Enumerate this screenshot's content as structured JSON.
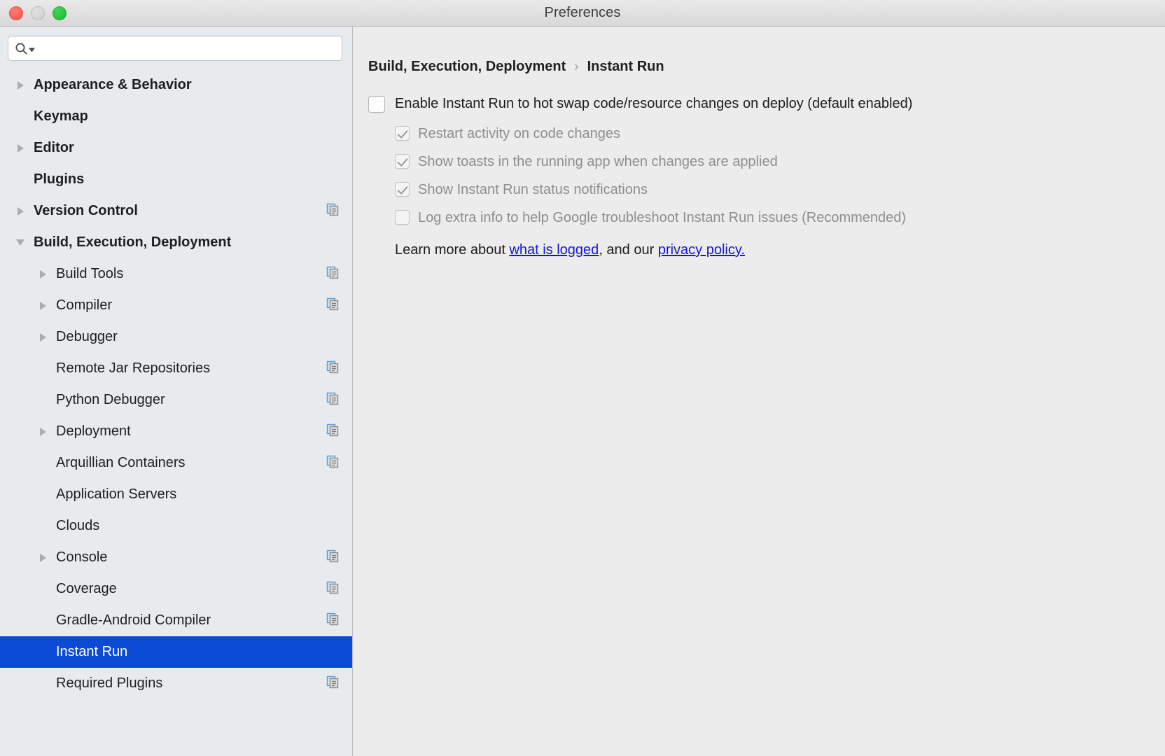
{
  "window": {
    "title": "Preferences",
    "traffic_lights": [
      "close-button",
      "minimize-button",
      "zoom-button"
    ]
  },
  "search": {
    "value": "",
    "placeholder": "",
    "icon": "search-icon",
    "dropdown_icon": "caret-down-icon"
  },
  "sidebar": {
    "items": [
      {
        "label": "Appearance & Behavior",
        "level": 0,
        "twisty": "right",
        "copy_icon": false,
        "selected": false
      },
      {
        "label": "Keymap",
        "level": 0,
        "twisty": "none",
        "copy_icon": false,
        "selected": false
      },
      {
        "label": "Editor",
        "level": 0,
        "twisty": "right",
        "copy_icon": false,
        "selected": false
      },
      {
        "label": "Plugins",
        "level": 0,
        "twisty": "none",
        "copy_icon": false,
        "selected": false
      },
      {
        "label": "Version Control",
        "level": 0,
        "twisty": "right",
        "copy_icon": true,
        "selected": false
      },
      {
        "label": "Build, Execution, Deployment",
        "level": 0,
        "twisty": "down",
        "copy_icon": false,
        "selected": false
      },
      {
        "label": "Build Tools",
        "level": 1,
        "twisty": "right",
        "copy_icon": true,
        "selected": false
      },
      {
        "label": "Compiler",
        "level": 1,
        "twisty": "right",
        "copy_icon": true,
        "selected": false
      },
      {
        "label": "Debugger",
        "level": 1,
        "twisty": "right",
        "copy_icon": false,
        "selected": false
      },
      {
        "label": "Remote Jar Repositories",
        "level": 1,
        "twisty": "none",
        "copy_icon": true,
        "selected": false
      },
      {
        "label": "Python Debugger",
        "level": 1,
        "twisty": "none",
        "copy_icon": true,
        "selected": false
      },
      {
        "label": "Deployment",
        "level": 1,
        "twisty": "right",
        "copy_icon": true,
        "selected": false
      },
      {
        "label": "Arquillian Containers",
        "level": 1,
        "twisty": "none",
        "copy_icon": true,
        "selected": false
      },
      {
        "label": "Application Servers",
        "level": 1,
        "twisty": "none",
        "copy_icon": false,
        "selected": false
      },
      {
        "label": "Clouds",
        "level": 1,
        "twisty": "none",
        "copy_icon": false,
        "selected": false
      },
      {
        "label": "Console",
        "level": 1,
        "twisty": "right",
        "copy_icon": true,
        "selected": false
      },
      {
        "label": "Coverage",
        "level": 1,
        "twisty": "none",
        "copy_icon": true,
        "selected": false
      },
      {
        "label": "Gradle-Android Compiler",
        "level": 1,
        "twisty": "none",
        "copy_icon": true,
        "selected": false
      },
      {
        "label": "Instant Run",
        "level": 1,
        "twisty": "none",
        "copy_icon": false,
        "selected": true
      },
      {
        "label": "Required Plugins",
        "level": 1,
        "twisty": "none",
        "copy_icon": true,
        "selected": false
      }
    ]
  },
  "content": {
    "breadcrumb": {
      "parent": "Build, Execution, Deployment",
      "separator": "›",
      "current": "Instant Run"
    },
    "options": [
      {
        "label": "Enable Instant Run to hot swap code/resource changes on deploy (default enabled)",
        "checked": false,
        "disabled": false,
        "indent": 0
      },
      {
        "label": "Restart activity on code changes",
        "checked": true,
        "disabled": true,
        "indent": 1
      },
      {
        "label": "Show toasts in the running app when changes are applied",
        "checked": true,
        "disabled": true,
        "indent": 1
      },
      {
        "label": "Show Instant Run status notifications",
        "checked": true,
        "disabled": true,
        "indent": 1
      },
      {
        "label": "Log extra info to help Google troubleshoot Instant Run issues (Recommended)",
        "checked": false,
        "disabled": true,
        "indent": 1
      }
    ],
    "learn_more": {
      "prefix": "Learn more about ",
      "link1": "what is logged",
      "middle": ", and our ",
      "link2": "privacy policy."
    }
  },
  "colors": {
    "selection_blue": "#0b4ad4",
    "link_blue": "#1414e0",
    "sidebar_bg": "#e7ebee",
    "content_bg": "#ececec",
    "titlebar_bg": "#dedede"
  }
}
